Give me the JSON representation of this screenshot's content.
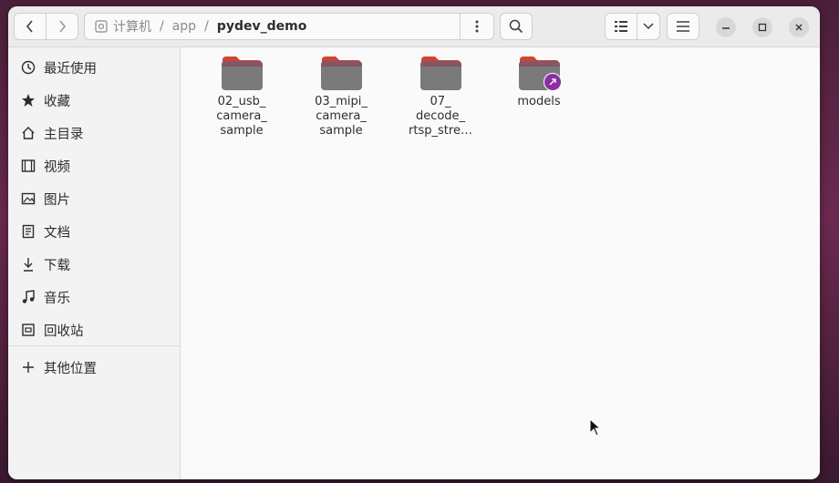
{
  "window": {
    "path": [
      "计算机",
      "app",
      "pydev_demo"
    ],
    "controls": {
      "minimize": "minimize-icon",
      "maximize": "maximize-icon",
      "close": "close-icon"
    }
  },
  "sidebar": {
    "items": [
      {
        "label": "最近使用",
        "icon": "clock-icon"
      },
      {
        "label": "收藏",
        "icon": "star-icon"
      },
      {
        "label": "主目录",
        "icon": "home-icon"
      },
      {
        "label": "视频",
        "icon": "video-icon"
      },
      {
        "label": "图片",
        "icon": "image-icon"
      },
      {
        "label": "文档",
        "icon": "document-icon"
      },
      {
        "label": "下载",
        "icon": "download-icon"
      },
      {
        "label": "音乐",
        "icon": "music-icon"
      },
      {
        "label": "回收站",
        "icon": "trash-icon"
      }
    ],
    "other_locations": {
      "label": "其他位置",
      "icon": "plus-icon"
    }
  },
  "files": [
    {
      "name": "02_usb_\ncamera_\nsample",
      "type": "folder"
    },
    {
      "name": "03_mipi_\ncamera_\nsample",
      "type": "folder"
    },
    {
      "name": "07_\ndecode_\nrtsp_stre…",
      "type": "folder"
    },
    {
      "name": "models",
      "type": "folder-link"
    }
  ],
  "colors": {
    "folder_tab": "#d0442f",
    "folder_body": "#7a7a7a",
    "link_badge": "#8a2fa3"
  }
}
